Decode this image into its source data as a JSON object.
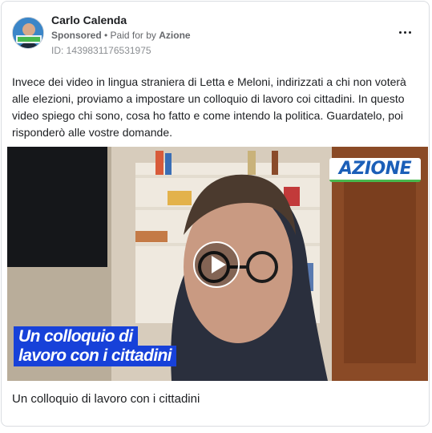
{
  "post": {
    "author": "Carlo Calenda",
    "sponsored": "Sponsored",
    "paid_prefix": " • Paid for by ",
    "paid_by": "Azione",
    "ad_id": "ID: 1439831176531975",
    "more_icon": "more-horizontal-icon",
    "text": "Invece dei video in lingua straniera di Letta e Meloni, indirizzati a chi non voterà alle elezioni, proviamo a impostare un colloquio di lavoro coi cittadini. In questo video spiego chi sono, cosa ho fatto e come intendo la politica. Guardatelo, poi risponderò alle vostre domande."
  },
  "video": {
    "logo": "AZIONE",
    "caption_line1": "Un colloquio di",
    "caption_line2_a": "lavoro con i ",
    "caption_line2_b": "cittadini",
    "play_icon": "play-icon"
  },
  "link": {
    "title": "Un colloquio di lavoro con i cittadini"
  },
  "colors": {
    "caption_bg": "#1741d9",
    "logo_text": "#1b5fb8",
    "logo_accent": "#48b84e"
  }
}
